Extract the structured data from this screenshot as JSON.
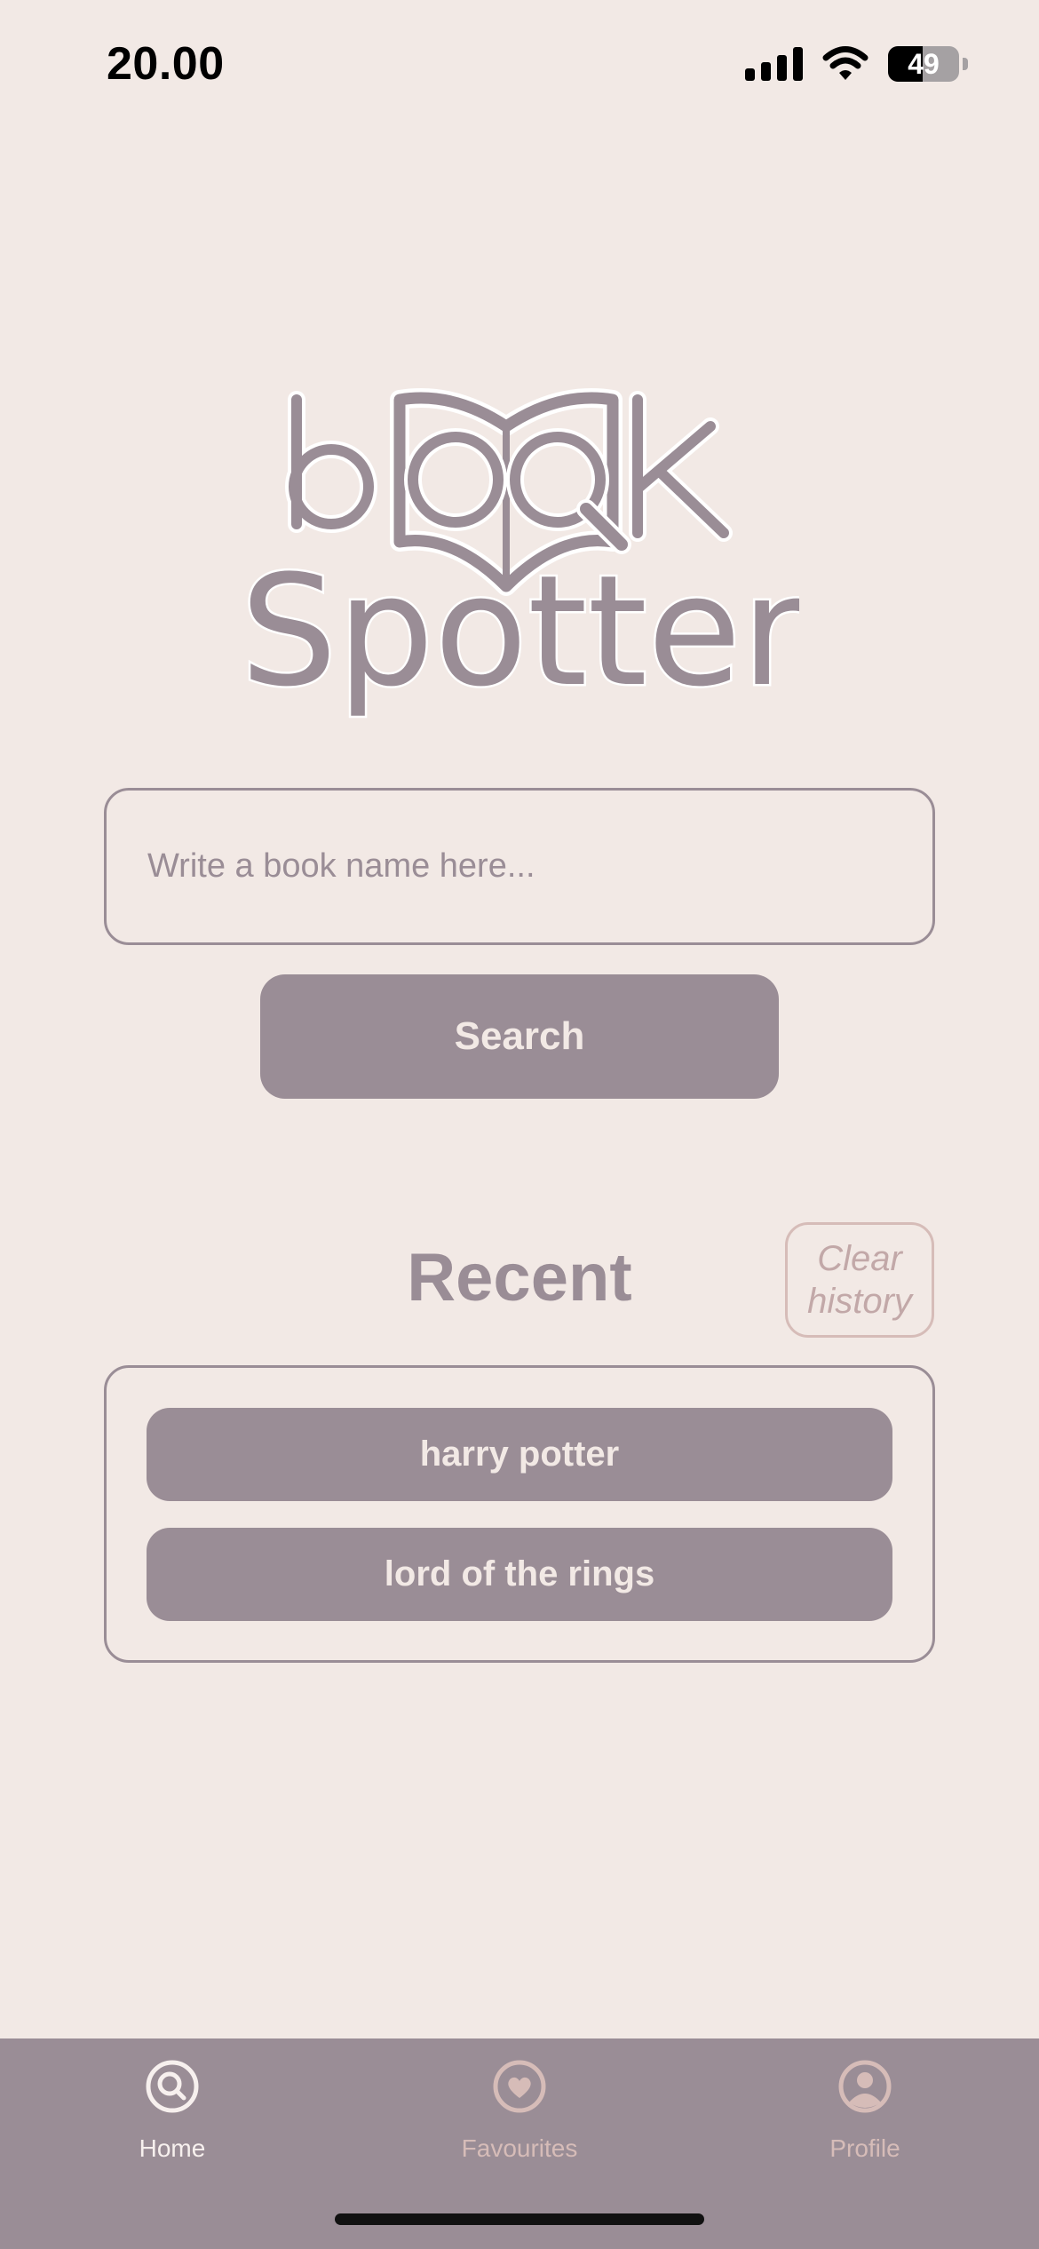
{
  "status_bar": {
    "time": "20.00",
    "battery_level": "49"
  },
  "logo": {
    "line1": "book",
    "line2": "Spotter"
  },
  "search": {
    "placeholder": "Write a book name here...",
    "value": "",
    "button_label": "Search"
  },
  "recent": {
    "title": "Recent",
    "clear_label": "Clear history",
    "items": [
      {
        "label": "harry potter"
      },
      {
        "label": "lord of the rings"
      }
    ]
  },
  "tabs": [
    {
      "label": "Home",
      "icon": "search-icon",
      "active": true
    },
    {
      "label": "Favourites",
      "icon": "heart-icon",
      "active": false
    },
    {
      "label": "Profile",
      "icon": "person-icon",
      "active": false
    }
  ],
  "colors": {
    "background": "#f2e9e5",
    "primary": "#9a8d96",
    "muted": "#d6bcb8",
    "tab_active": "#f7f0ee"
  }
}
